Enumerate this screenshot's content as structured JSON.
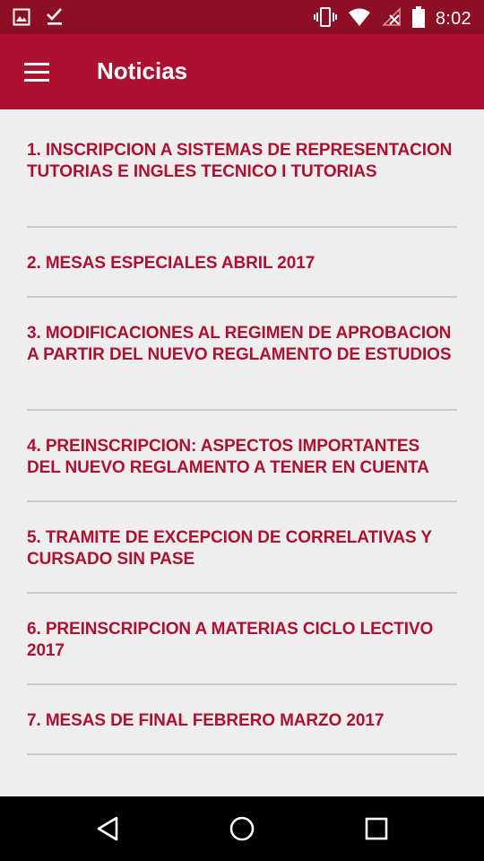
{
  "status_bar": {
    "time": "8:02",
    "icons": [
      "image-icon",
      "check-download-icon",
      "vibrate-icon",
      "wifi-icon",
      "no-signal-icon",
      "battery-icon"
    ]
  },
  "toolbar": {
    "title": "Noticias",
    "menu_icon": "hamburger-menu-icon"
  },
  "news": {
    "items": [
      {
        "label": "1. INSCRIPCION A SISTEMAS DE REPRESENTACION TUTORIAS E INGLES TECNICO I TUTORIAS"
      },
      {
        "label": "2. MESAS ESPECIALES ABRIL 2017"
      },
      {
        "label": "3. MODIFICACIONES AL REGIMEN DE APROBACION A PARTIR DEL NUEVO REGLAMENTO DE ESTUDIOS"
      },
      {
        "label": "4. PREINSCRIPCION: ASPECTOS IMPORTANTES DEL NUEVO REGLAMENTO A TENER EN CUENTA"
      },
      {
        "label": "5. TRAMITE DE EXCEPCION DE CORRELATIVAS Y CURSADO SIN PASE"
      },
      {
        "label": "6. PREINSCRIPCION A MATERIAS CICLO LECTIVO 2017"
      },
      {
        "label": "7. MESAS DE FINAL FEBRERO MARZO 2017"
      }
    ]
  },
  "nav_bar": {
    "icons": [
      "back-icon",
      "home-icon",
      "recents-icon"
    ]
  },
  "colors": {
    "status_bar": "#8c0f26",
    "toolbar": "#ad1131",
    "accent_text": "#ad1131",
    "background": "#eeeeee",
    "divider": "#cccccc"
  }
}
